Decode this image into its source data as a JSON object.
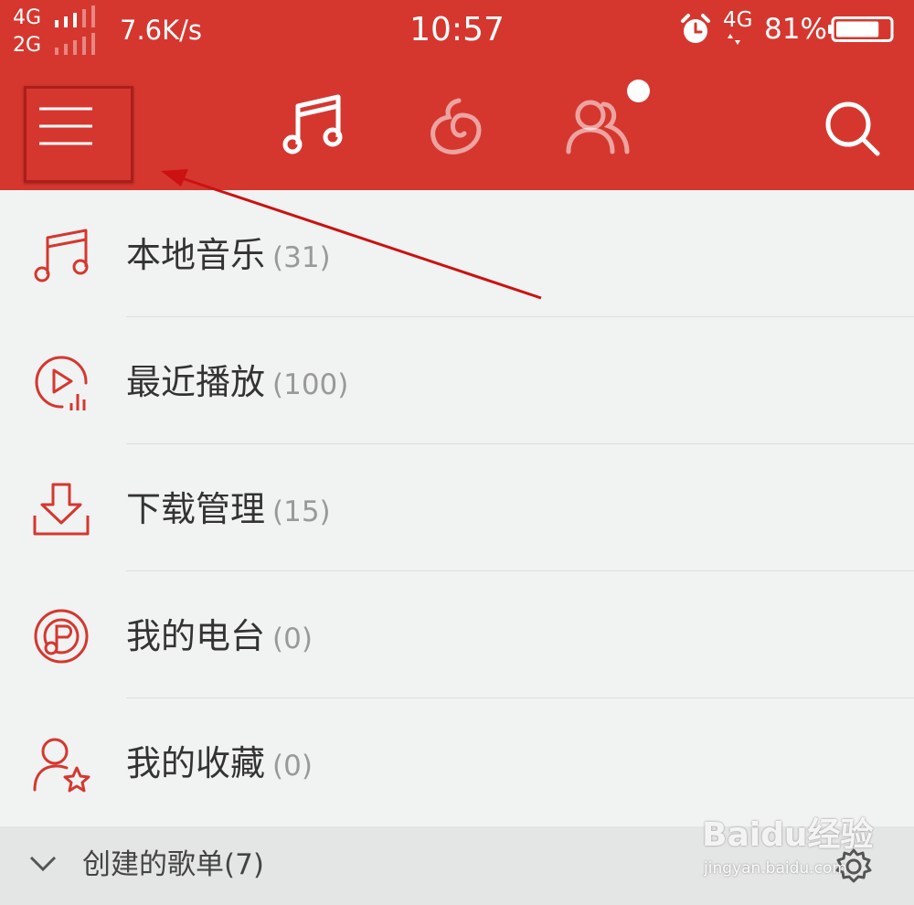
{
  "status_bar": {
    "network_primary": "4G",
    "network_secondary": "2G",
    "net_speed": "7.6K/s",
    "time": "10:57",
    "data_network": "4G",
    "battery_percent": "81%",
    "battery_level": 0.81,
    "icons": [
      "signal-icon",
      "alarm-icon",
      "battery-icon"
    ]
  },
  "toolbar": {
    "menu_icon": "hamburger-menu-icon",
    "tabs": [
      {
        "icon": "music-note-icon",
        "active": true
      },
      {
        "icon": "discover-icon",
        "active": false
      },
      {
        "icon": "friends-icon",
        "active": false,
        "badge": true
      }
    ],
    "search_icon": "search-icon"
  },
  "menu_items": [
    {
      "label": "本地音乐",
      "count": "(31)",
      "icon": "music-note-icon"
    },
    {
      "label": "最近播放",
      "count": "(100)",
      "icon": "recent-play-icon"
    },
    {
      "label": "下载管理",
      "count": "(15)",
      "icon": "download-icon"
    },
    {
      "label": "我的电台",
      "count": "(0)",
      "icon": "radio-icon"
    },
    {
      "label": "我的收藏",
      "count": "(0)",
      "icon": "favorite-user-icon"
    }
  ],
  "section": {
    "label": "创建的歌单(7)",
    "chevron_icon": "chevron-down-icon",
    "settings_icon": "gear-icon"
  },
  "watermark": {
    "main": "Baidu经验",
    "sub": "jingyan.baidu.com"
  },
  "colors": {
    "brand_red": "#d5372f",
    "icon_red": "#d5372f",
    "list_background": "#f1f3f2",
    "annotation_red": "#cc1111"
  }
}
